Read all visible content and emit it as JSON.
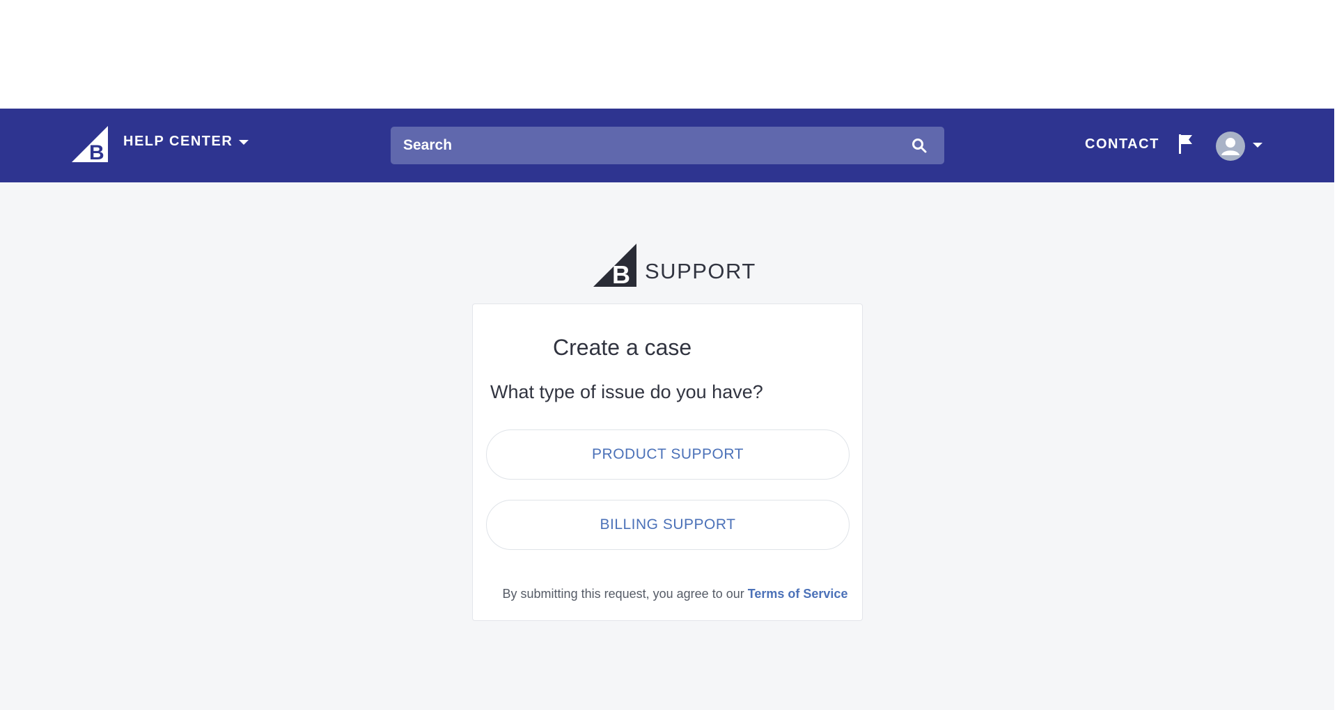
{
  "nav": {
    "logo_icon": "bigcommerce-logo-icon",
    "help_center_label": "HELP CENTER",
    "search_placeholder": "Search",
    "search_icon": "search-icon",
    "contact_label": "CONTACT",
    "flag_icon": "flag-icon",
    "avatar_icon": "user-avatar-icon",
    "background_color": "#2e3490",
    "search_background_color": "#6068ad"
  },
  "brand": {
    "support_label": "SUPPORT"
  },
  "card": {
    "title": "Create a case",
    "question": "What type of issue do you have?",
    "options": [
      {
        "label": "PRODUCT SUPPORT"
      },
      {
        "label": "BILLING SUPPORT"
      }
    ],
    "terms_prefix": "By submitting this request, you agree to our ",
    "terms_link": "Terms of Service"
  },
  "colors": {
    "page_background": "#f5f6f8",
    "link_blue": "#4b71b8",
    "progress_red": "#d8393b"
  }
}
